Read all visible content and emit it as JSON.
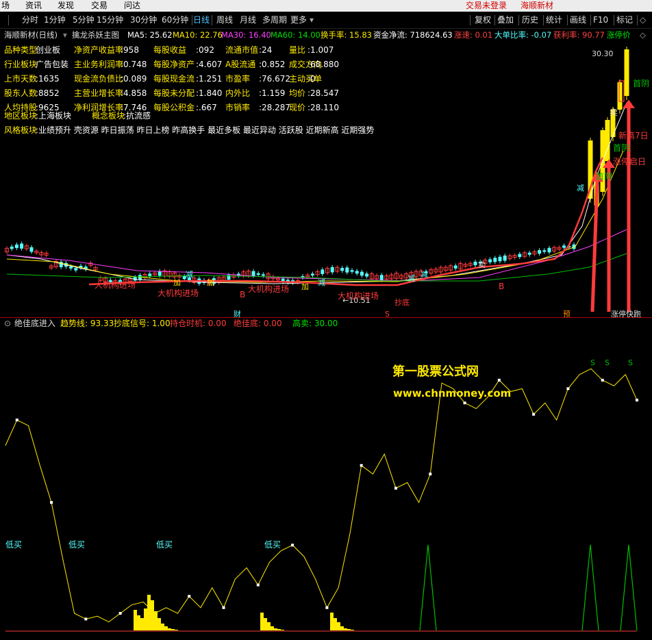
{
  "menu": {
    "items": [
      "场",
      "资讯",
      "发现",
      "交易",
      "问达"
    ],
    "login_status": "交易未登录",
    "product": "海顺新材"
  },
  "periods": [
    "分时",
    "1分钟",
    "5分钟",
    "15分钟",
    "30分钟",
    "60分钟",
    "日线",
    "周线",
    "月线",
    "多周期",
    "更多"
  ],
  "active_period": "日线",
  "right_buttons": [
    "复权",
    "叠加",
    "历史",
    "统计",
    "画线",
    "F10",
    "标记"
  ],
  "ma_header": {
    "stock": "海顺新材(日线)",
    "indicator": "擒龙杀妖主图",
    "ma5": "MA5: 25.62",
    "ma10": "MA10: 22.76",
    "ma30": "MA30: 16.40",
    "ma60": "MA60: 14.00",
    "turnover": "换手率: 15.83",
    "capital_flow": "资金净流: 718624.63",
    "speed": "涨速: 0.01",
    "big_order": "大单比率: -0.07",
    "profit_ratio": "获利率: 90.77",
    "limit": "涨停价"
  },
  "info": {
    "row1": [
      [
        "品种类型",
        "创业板"
      ],
      [
        "净资产收益率",
        ":958"
      ],
      [
        "每股收益",
        ":092"
      ],
      [
        "流通市值",
        ":24"
      ],
      [
        "量比",
        ":1.007"
      ]
    ],
    "row2": [
      [
        "行业板块",
        "广告包装"
      ],
      [
        "主业务利润率",
        ":0.748"
      ],
      [
        "每股净资产",
        ":4.607"
      ],
      [
        "A股流通",
        ":0.852"
      ],
      [
        "成交方向",
        ":68.880"
      ]
    ],
    "row3": [
      [
        "上市天数",
        ":1635"
      ],
      [
        "现金流负债比",
        ":0.089"
      ],
      [
        "每股现金流",
        ":1.251"
      ],
      [
        "市盈率",
        ":76.672"
      ],
      [
        "主动买单",
        ":0"
      ]
    ],
    "row4": [
      [
        "股东人数",
        ":8852"
      ],
      [
        "主营业增长率",
        ":4.858"
      ],
      [
        "每股未分配",
        ":1.840"
      ],
      [
        "内外比",
        ":1.159"
      ],
      [
        "均价",
        ":28.547"
      ]
    ],
    "row5": [
      [
        "人均持股",
        ":9625"
      ],
      [
        "净利润增长率",
        ":7.746"
      ],
      [
        "每股公积金",
        ":.667"
      ],
      [
        "市销率",
        ":28.287"
      ],
      [
        "现价",
        ":28.110"
      ]
    ],
    "region": [
      "地区板块",
      ":上海板块",
      "概念板块",
      ":抗流感"
    ],
    "style": [
      "风格板块",
      ":业绩预升 壳资源 昨日振荡 昨日上榜 昨高换手 最近多板 最近异动 活跃股 近期新高 近期强势"
    ]
  },
  "chart_labels": {
    "price_high": "30.30",
    "price_low": "←10.51",
    "first_yin": "首阴",
    "sell": "卖",
    "reduce": "减",
    "add": "加",
    "big_fund": "大机构进场",
    "buy_b": "B",
    "sell_s": "S",
    "finance": "财",
    "pre": "预",
    "limit_run": "涨停快跑",
    "new_high": "新高7日",
    "rise": "涨停启日",
    "bottom": "抄底"
  },
  "sub_header": {
    "name": "绝佳底进入",
    "trend": "趋势线: 93.33",
    "bottom_signal": "抄底信号: 1.00",
    "hold": "持仓时机: 0.00",
    "best_bottom": "绝佳底: 0.00",
    "high_sell": "高卖: 30.00"
  },
  "sub_labels": {
    "low_buy": "低买",
    "s": "S"
  },
  "watermark": {
    "line1": "第一股票公式网",
    "line2": "www.chnmoney.com"
  },
  "colors": {
    "up": "#ff3b3b",
    "down": "#54ffff",
    "yellow": "#ffea00",
    "magenta": "#ff40ff",
    "green": "#00c000",
    "accent": "#4fc3ff"
  },
  "chart_data": {
    "type": "candlestick",
    "trend_line": [
      65,
      74,
      72,
      58,
      45,
      25,
      6,
      4,
      5,
      3,
      6,
      9,
      10,
      6,
      8,
      6,
      12,
      8,
      15,
      8,
      18,
      22,
      16,
      24,
      28,
      30,
      26,
      18,
      8,
      15,
      34,
      58,
      55,
      62,
      50,
      52,
      45,
      55,
      87,
      85,
      80,
      78,
      82,
      88,
      84,
      85,
      76,
      80,
      74,
      85,
      90,
      92,
      88,
      86,
      90,
      81
    ]
  }
}
